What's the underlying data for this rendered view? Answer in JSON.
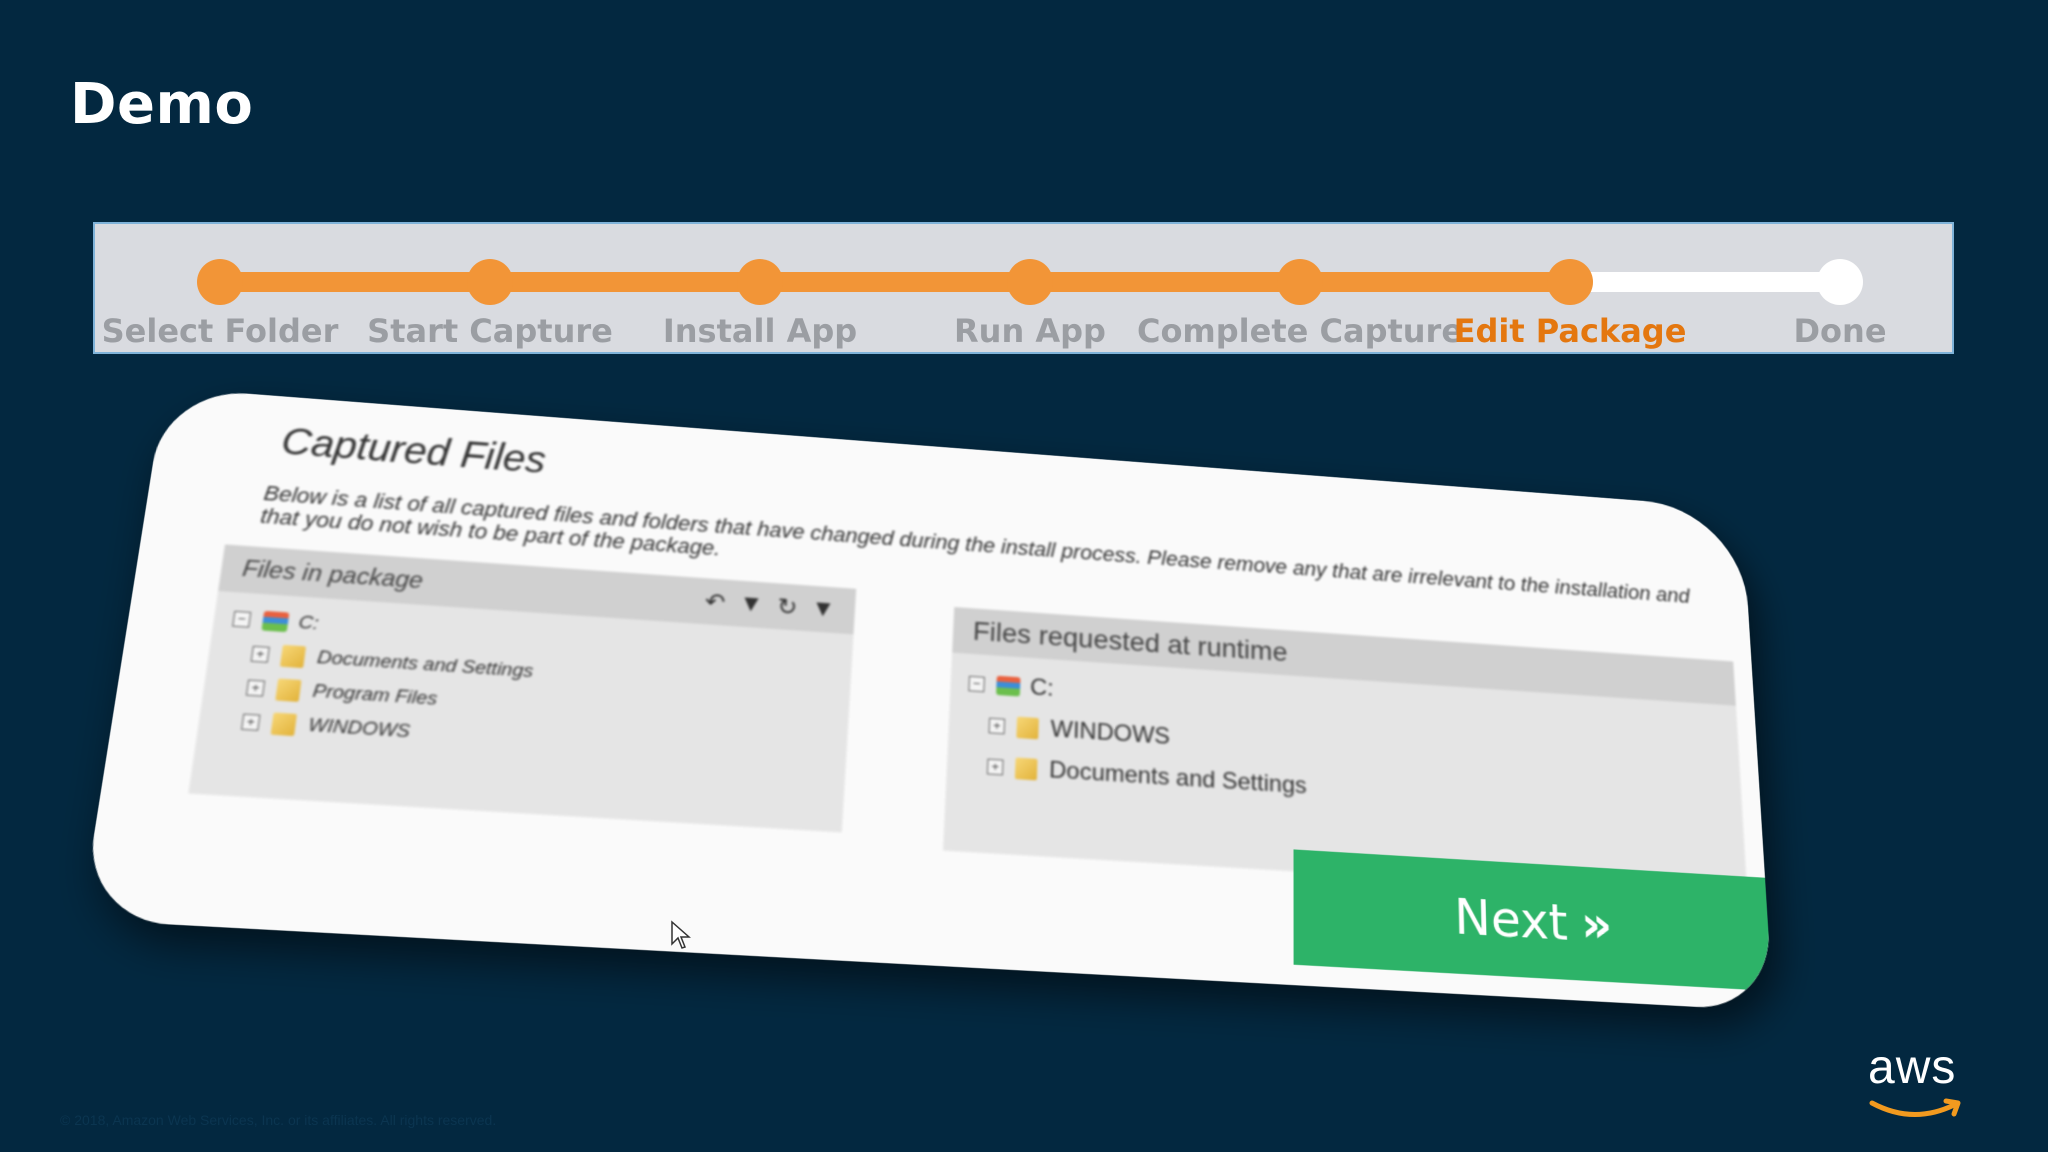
{
  "slide": {
    "title": "Demo",
    "footer": "© 2018, Amazon Web Services, Inc. or its affiliates. All rights reserved.",
    "logo_text": "aws"
  },
  "progress": {
    "completed_fraction": 0.8333,
    "colors": {
      "done": "#f29537",
      "todo": "#ffffff",
      "active_label": "#e4770f",
      "label": "#9b9ea3"
    },
    "steps": [
      {
        "label": "Select Folder",
        "state": "done"
      },
      {
        "label": "Start Capture",
        "state": "done"
      },
      {
        "label": "Install App",
        "state": "done"
      },
      {
        "label": "Run App",
        "state": "done"
      },
      {
        "label": "Complete Capture",
        "state": "done"
      },
      {
        "label": "Edit Package",
        "state": "active"
      },
      {
        "label": "Done",
        "state": "todo"
      }
    ]
  },
  "wizard": {
    "title": "Captured Files",
    "description": "Below is a list of all captured files and folders that have changed during the install process. Please remove any that are irrelevant to the installation and that you do not wish to be part of the package.",
    "left_panel": {
      "title": "Files in package",
      "icons": [
        "undo-icon",
        "dropdown-icon",
        "refresh-icon",
        "dropdown-icon"
      ],
      "tree": [
        {
          "label": "C:",
          "toggle": "⊟",
          "icon": "drive-icon",
          "child": false
        },
        {
          "label": "Documents and Settings",
          "toggle": "⊞",
          "icon": "folder-icon",
          "child": true
        },
        {
          "label": "Program Files",
          "toggle": "⊞",
          "icon": "folder-icon",
          "child": true
        },
        {
          "label": "WINDOWS",
          "toggle": "⊞",
          "icon": "folder-icon",
          "child": true
        }
      ]
    },
    "right_panel": {
      "title": "Files requested at runtime",
      "tree": [
        {
          "label": "C:",
          "toggle": "⊟",
          "icon": "drive-icon",
          "child": false
        },
        {
          "label": "WINDOWS",
          "toggle": "⊞",
          "icon": "folder-icon",
          "child": true
        },
        {
          "label": "Documents and Settings",
          "toggle": "⊞",
          "icon": "folder-icon",
          "child": true
        }
      ]
    },
    "next_button": {
      "label": "Next",
      "chevron": "»",
      "color": "#2db368"
    }
  }
}
